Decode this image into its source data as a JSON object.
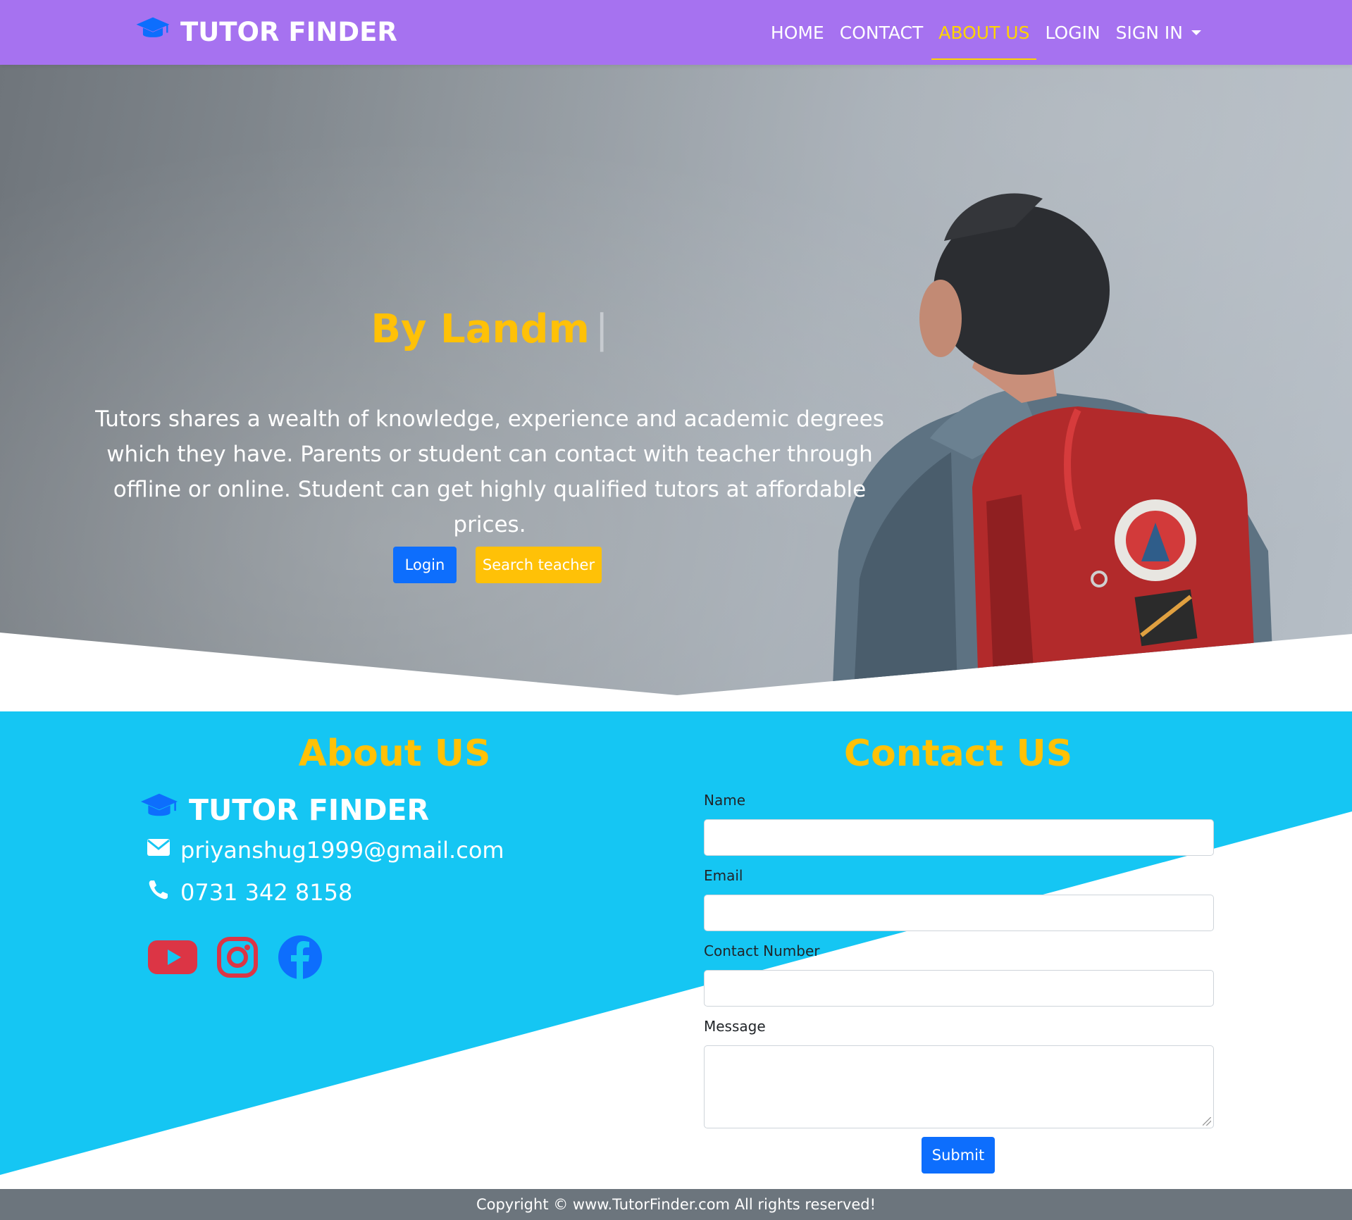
{
  "navbar": {
    "brand": "TUTOR FINDER",
    "links": [
      "HOME",
      "CONTACT",
      "ABOUT US",
      "LOGIN",
      "SIGN IN"
    ],
    "active": "ABOUT US"
  },
  "hero": {
    "title": "By Landm",
    "cursor": "|",
    "text": "Tutors shares a wealth of knowledge, experience and academic degrees which they have. Parents or student can contact with teacher through offline or online. Student can get highly qualified tutors at affordable prices.",
    "login_button": "Login",
    "search_button": "Search teacher"
  },
  "about": {
    "title": "About US",
    "brand": "TUTOR FINDER",
    "email": "priyanshug1999@gmail.com",
    "phone": "0731 342 8158",
    "social_icons": [
      "youtube-icon",
      "instagram-icon",
      "facebook-icon"
    ]
  },
  "contact": {
    "title": "Contact US",
    "name_label": "Name",
    "email_label": "Email",
    "number_label": "Contact Number",
    "message_label": "Message",
    "submit": "Submit"
  },
  "footer": {
    "copyright": "Copyright © www.TutorFinder.com All rights reserved!"
  },
  "colors": {
    "navbar": "#a672f0",
    "accent_yellow": "#ffc107",
    "section_cyan": "#15c6f3",
    "primary_blue": "#0d6efd",
    "footer_gray": "#6c757d"
  }
}
